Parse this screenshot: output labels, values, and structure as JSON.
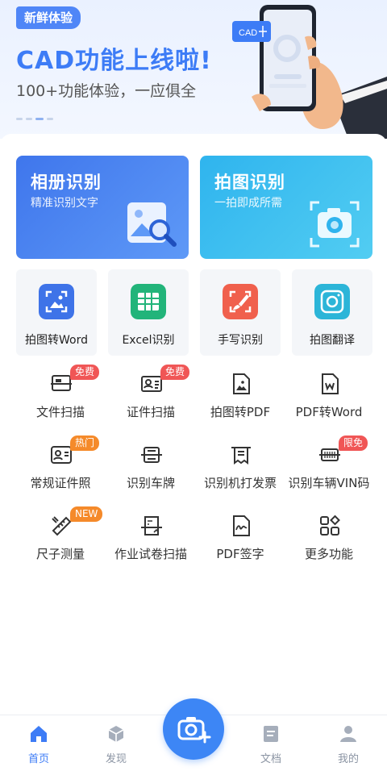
{
  "banner": {
    "badge": "新鲜体验",
    "title": "CAD功能上线啦!",
    "subtitle": "100+功能体验，一应俱全",
    "phone_tag": "CAD"
  },
  "cards": [
    {
      "title": "相册识别",
      "subtitle": "精准识别文字"
    },
    {
      "title": "拍图识别",
      "subtitle": "一拍即成所需"
    }
  ],
  "tiles": [
    {
      "label": "拍图转Word",
      "icon": "photo-frame-icon",
      "color": "#3e73e8"
    },
    {
      "label": "Excel识别",
      "icon": "spreadsheet-icon",
      "color": "#22b47a"
    },
    {
      "label": "手写识别",
      "icon": "brush-icon",
      "color": "#f0604d"
    },
    {
      "label": "拍图翻译",
      "icon": "camera-lens-icon",
      "color": "#2cb5d8"
    }
  ],
  "functions": [
    {
      "label": "文件扫描",
      "tag": "免费"
    },
    {
      "label": "证件扫描",
      "tag": "免费"
    },
    {
      "label": "拍图转PDF",
      "tag": ""
    },
    {
      "label": "PDF转Word",
      "tag": ""
    },
    {
      "label": "常规证件照",
      "tag": "热门"
    },
    {
      "label": "识别车牌",
      "tag": ""
    },
    {
      "label": "识别机打发票",
      "tag": ""
    },
    {
      "label": "识别车辆VIN码",
      "tag": "限免"
    },
    {
      "label": "尺子测量",
      "tag": "NEW"
    },
    {
      "label": "作业试卷扫描",
      "tag": ""
    },
    {
      "label": "PDF签字",
      "tag": ""
    },
    {
      "label": "更多功能",
      "tag": ""
    }
  ],
  "tabbar": [
    {
      "label": "首页",
      "icon": "home-icon",
      "active": true
    },
    {
      "label": "发现",
      "icon": "cube-icon",
      "active": false
    },
    {
      "label": "文档",
      "icon": "document-icon",
      "active": false
    },
    {
      "label": "我的",
      "icon": "user-icon",
      "active": false
    }
  ],
  "colors": {
    "accent": "#3d7cf6",
    "tag_red": "#f05656",
    "tag_orange": "#f58a2a"
  }
}
